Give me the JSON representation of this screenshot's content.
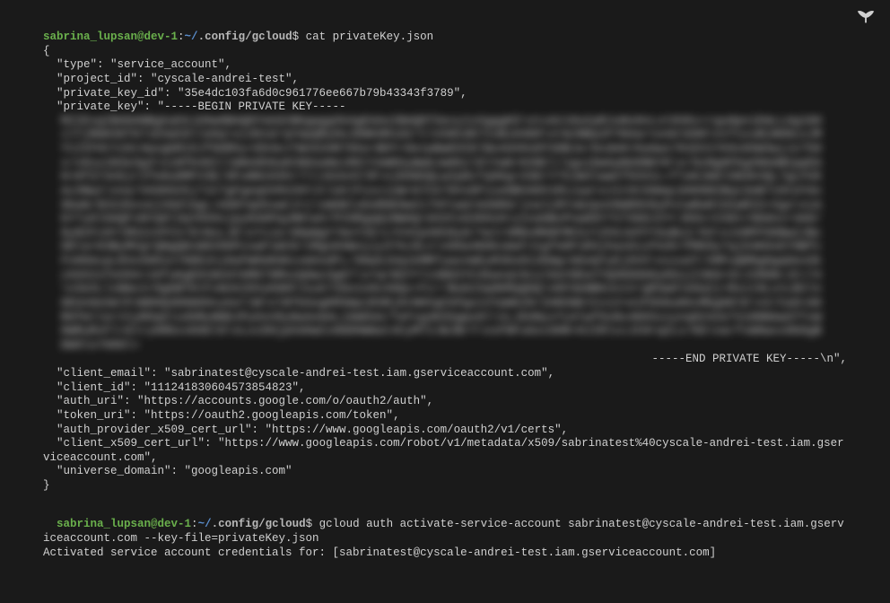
{
  "logo_name": "bird-logo-icon",
  "prompt1": {
    "user_host": "sabrina_lupsan@dev-1",
    "colon": ":",
    "path_prefix": "~/",
    "path_rest": ".config/gcloud",
    "dollar": "$ ",
    "command": "cat privateKey.json"
  },
  "json": {
    "open_brace": "{",
    "line_type": "  \"type\": \"service_account\",",
    "line_project": "  \"project_id\": \"cyscale-andrei-test\",",
    "line_keyid": "  \"private_key_id\": \"35e4dc103fa6d0c961776ee667b79b43343f3789\",",
    "line_privatekey_start": "  \"private_key\": \"-----BEGIN PRIVATE KEY-----",
    "blurred_key_body": "MIIEvgIBADANBgkqhkiG9w0BAQEFAASCBKgwggSkAgEAAoIBAQDTSexy1sXgggK5\\ntxdz10uCpRJuNs0nLvt9VKs+rguHpniEmLLAg16HilTjRm036T67iEXwCDlleGq\\ni361d/qYApQRyHoJDNK9R1d2/tl430Cd67IxBi04DH\\nrWJNBa2FYN4arte4AlG90\\ntf1xxBiNH0cxJMYt2IFHtYzbt4wxgbR15Jf0OR5y+EK4eJ7Wn534R76ke+BOY+GeiwNwEOIKlNo4d49sEFXDBJe/DxdeKrKaAws701EX1Yk6x0SW3wjJz759x/v6vy1N3e3g3\\niNfK48IllmN4dh0uKCNOnaNeiR6lYeWKbyWwbJwKKzl6lYwKrKXNCl/1guiDwkpNUONKYK\\n/GzNgHFKgXNAABCppEAH=0fZrSnbjrIfe8u0MFV3E/dFuNN193hr7llJA2e4IlR\\njDSNSQLwIpDcTq5Kg=33ErY75JW3lwwCf9331L+fleKJmGlSN3kVQL7gLFU5Az3Nw1\\nna/VASK025j71C7gFgeqUVHV26YJtleklFsxcioW=G7Ck70VxDF1xe8BVADV1R1Jyw\\nJ1t9t50mqLb009DCBq13eB719tUYAn9baN/9Ck35vvejVGdlAgL+A98YqUhxwCJrc\\nmGNlxEeRHE0wVi7hFtwUrm3GRd/jnalcRYxWJpoV0mR9V0yPvtwRaNlOIwRIS+Vgo\\niAbY7yGlOAQFxNYq0l3qYHXOvjpyKAGPqyNNlwV/PIGRgqQ1NWAQ=d42CxG2KHxH+y1naGBxPvw89Y7V7SGOJ2YrJK6v+CXDtrGDdncr4A0/8yNIFcHYlR52zVFCV/EtNxLJE\\n7cie/d0pWgY7mvYIE+LYV4IpXKh0y0/YwlrSMDxMH8FMCSJl2h5JeFFYSoBsI/93\\nJnRPFOONw2JNcODla×93ByMVgrQNgQDcW9206PzxwF1mC0/xMgo04Wvyjy37kcOLv\\nOOa4KDkxmeFJ1gfeDFsR4jhasOizFkdV/PRK9y7qj54KHxEY9BfcFnHOAcpLR3x5801n70DE2nj8aFWHUKGKxxmXodFL/9GwSJUq1kMMTywxnmEyR3GsD12EWg+bEeQYyEjOVX\\nxxuUT/XMFuQRRgDgqOesSkckb52sfeS94=16fuKgE01NnUYAM079MnzQdwx3g67\\n7qrNSYYltANO2YC4kwvqt6cul6aYDEaYYQSKDOG6yEEojI3KG=StJIRGN=JC+74\\n3eXLlsNmv1r0gbBTEtFxNnk2OVyK8KFJsuk72Go1n0v49Qx+Fz//Bub23q0KMqQGQ\\nKFdeNBknniV/gR3wOleGaZj+Rxct8LvtLBIlnGEUn0eSmlPJWDOQ4D0mG9vyke7JW\\nlNTbSogKM3mpiR3Rj6tNHVgCkPgoiVYpWkZ0/ZARZWblCx12=e1FDSGuKKxMbgGDlE\\n2/CaO=A0R6fmllertCyROq5lxdSMyNNDJPyOsV8yNaAoGALiGmEbA/TeFvg4KS5gwx0l\\nLJ84NyxTu4lwf9xNx4KK5xxynq8242e7VxDNNAwSTTxWHWRuRvFl=Glry6RbxxKGbl6\\nLxcD9jphAHwCx0DDHWmat4CyMTIJWJBrY\\nxFNFuGxcOHR=HJIRlccJCHrqZLv/Kb\\narfvW0wxx0b6gBDW9lo7008l=",
    "line_privatekey_end": "-----END PRIVATE KEY-----\\n\",",
    "line_client_email": "  \"client_email\": \"sabrinatest@cyscale-andrei-test.iam.gserviceaccount.com\",",
    "line_client_id": "  \"client_id\": \"111241830604573854823\",",
    "line_auth_uri": "  \"auth_uri\": \"https://accounts.google.com/o/oauth2/auth\",",
    "line_token_uri": "  \"token_uri\": \"https://oauth2.googleapis.com/token\",",
    "line_auth_provider": "  \"auth_provider_x509_cert_url\": \"https://www.googleapis.com/oauth2/v1/certs\",",
    "line_client_cert": "  \"client_x509_cert_url\": \"https://www.googleapis.com/robot/v1/metadata/x509/sabrinatest%40cyscale-andrei-test.iam.gserviceaccount.com\",",
    "line_universe": "  \"universe_domain\": \"googleapis.com\"",
    "close_brace": "}"
  },
  "prompt2": {
    "user_host": "sabrina_lupsan@dev-1",
    "colon": ":",
    "path_prefix": "~/",
    "path_rest": ".config/gcloud",
    "dollar": "$ ",
    "command": "gcloud auth activate-service-account sabrinatest@cyscale-andrei-test.iam.gserviceaccount.com --key-file=privateKey.json"
  },
  "result_line": "Activated service account credentials for: [sabrinatest@cyscale-andrei-test.iam.gserviceaccount.com]"
}
